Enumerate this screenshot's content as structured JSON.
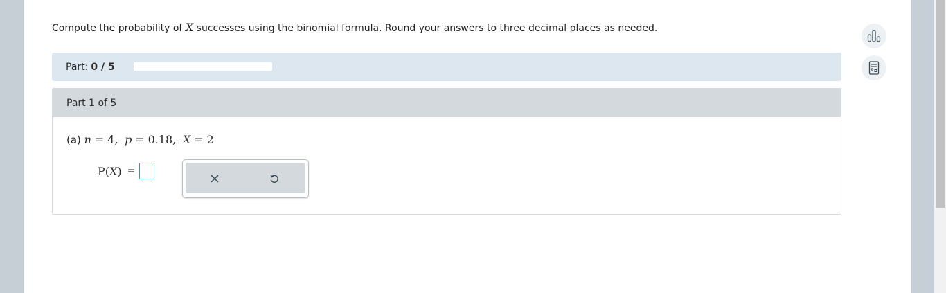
{
  "instructions": {
    "before": "Compute the probability of ",
    "variable": "X",
    "after": " successes using the binomial formula. Round your answers to three decimal places as needed."
  },
  "progress": {
    "label": "Part:",
    "count": "0 / 5",
    "fraction": 0
  },
  "part": {
    "title": "Part 1 of 5",
    "question": {
      "prefix": "(a) ",
      "n_var": "n",
      "n_val": "= 4,",
      "p_var": "p",
      "p_val": "= 0.18,",
      "x_var": "X",
      "x_val": "= 2"
    },
    "answer": {
      "label_fn": "P",
      "label_open": "(",
      "label_var": "X",
      "label_close": ")",
      "equals": "=",
      "value": ""
    }
  },
  "tools": {
    "clear_icon": "x-icon",
    "undo_icon": "undo-icon"
  },
  "sidebar": {
    "stats_icon": "bar-chart-icon",
    "calculator_icon": "calculator-icon"
  },
  "colors": {
    "progress_bg": "#dde7ef",
    "part_header_bg": "#d3d9dd",
    "input_border": "#3a9aa8",
    "page_bg": "#c5cfd5"
  }
}
